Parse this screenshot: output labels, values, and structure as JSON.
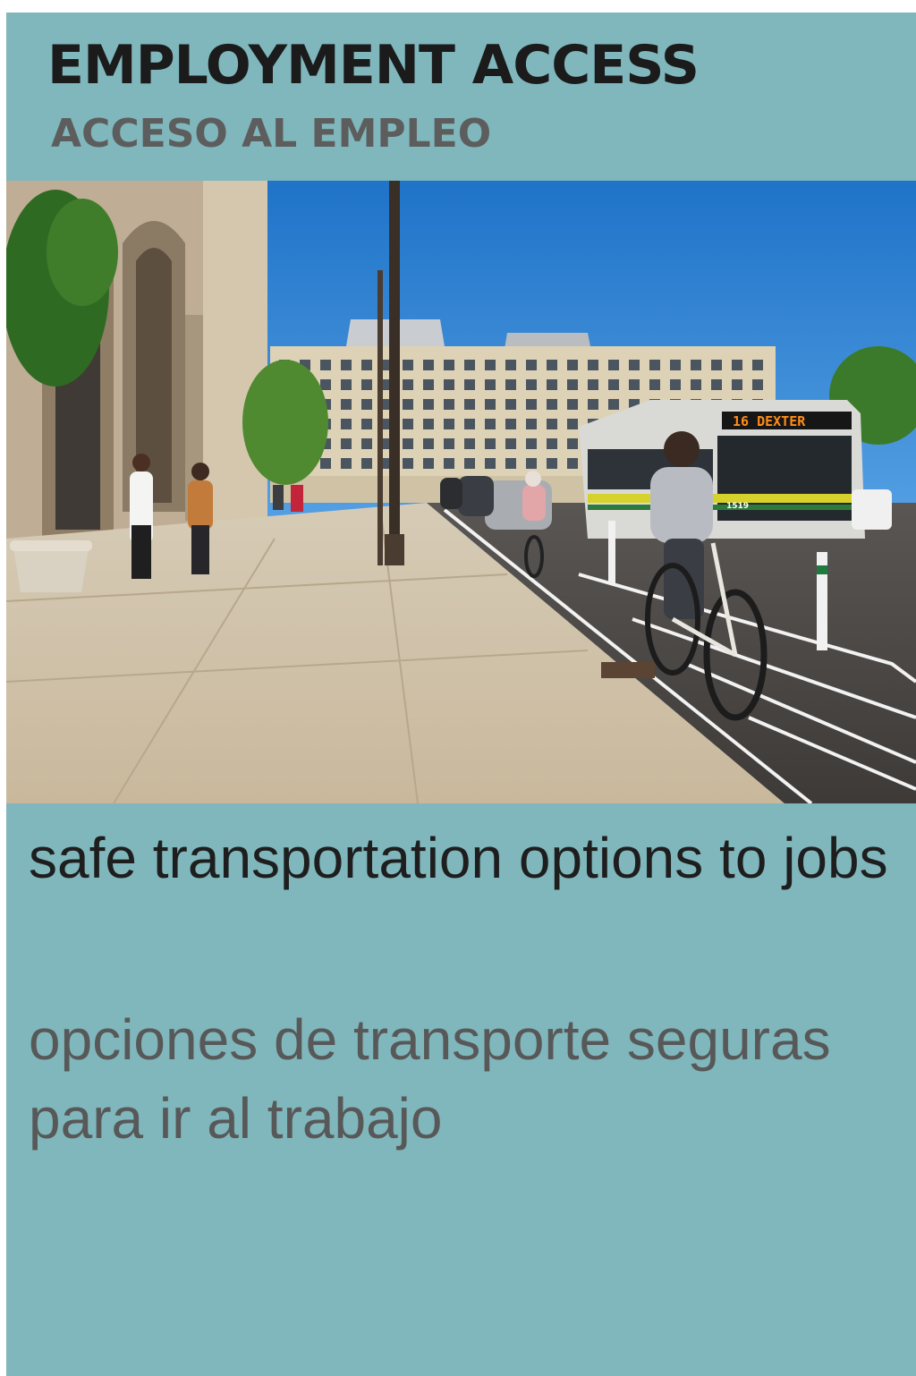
{
  "poster": {
    "title_en": "EMPLOYMENT ACCESS",
    "title_es": "ACCESO AL EMPLEO",
    "caption_en": "safe transportation options to jobs",
    "caption_es": "opciones de transporte seguras para ir al trabajo",
    "bus_sign": "16  DEXTER",
    "bus_number": "1519"
  },
  "colors": {
    "panel": "#7fb7bc",
    "title_dark": "#1b1b1b",
    "title_gray": "#5d5d5d"
  }
}
